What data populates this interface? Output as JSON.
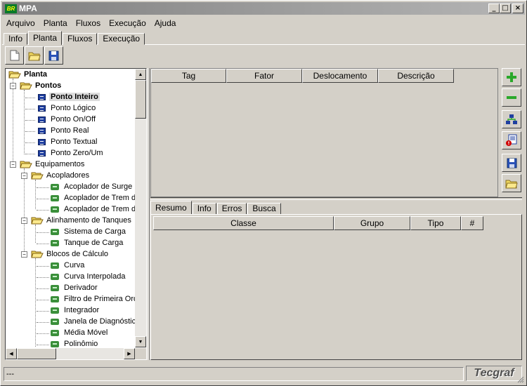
{
  "window": {
    "title": "MPA",
    "logo_text": "BR"
  },
  "menu": [
    "Arquivo",
    "Planta",
    "Fluxos",
    "Execução",
    "Ajuda"
  ],
  "top_tabs": [
    "Info",
    "Planta",
    "Fluxos",
    "Execução"
  ],
  "active_top_tab": "Planta",
  "tree": {
    "root": "Planta",
    "pontos": {
      "label": "Pontos",
      "items": [
        "Ponto Inteiro",
        "Ponto Lógico",
        "Ponto On/Off",
        "Ponto Real",
        "Ponto Textual",
        "Ponto Zero/Um"
      ],
      "selected": "Ponto Inteiro"
    },
    "equipamentos": {
      "label": "Equipamentos",
      "groups": [
        {
          "label": "Acopladores",
          "items": [
            "Acoplador de Surge P",
            "Acoplador de Trem de",
            "Acoplador de Trem de"
          ]
        },
        {
          "label": "Alinhamento de Tanques",
          "items": [
            "Sistema de Carga",
            "Tanque de Carga"
          ]
        },
        {
          "label": "Blocos de Cálculo",
          "items": [
            "Curva",
            "Curva Interpolada",
            "Derivador",
            "Filtro de Primeira Ord",
            "Integrador",
            "Janela de Diagnóstico",
            "Média Móvel",
            "Polinômio"
          ]
        }
      ]
    }
  },
  "top_table": {
    "columns": [
      "Tag",
      "Fator",
      "Deslocamento",
      "Descrição"
    ]
  },
  "bottom_tabs": [
    "Resumo",
    "Info",
    "Erros",
    "Busca"
  ],
  "active_bottom_tab": "Resumo",
  "bottom_table": {
    "columns": [
      "Classe",
      "Grupo",
      "Tipo",
      "#"
    ]
  },
  "status": {
    "text": "---",
    "brand": "Tecgraf"
  },
  "colors": {
    "title_start": "#808080",
    "title_end": "#b5b5b5",
    "background": "#d4d0c8",
    "selection": "#dcdcdc"
  }
}
